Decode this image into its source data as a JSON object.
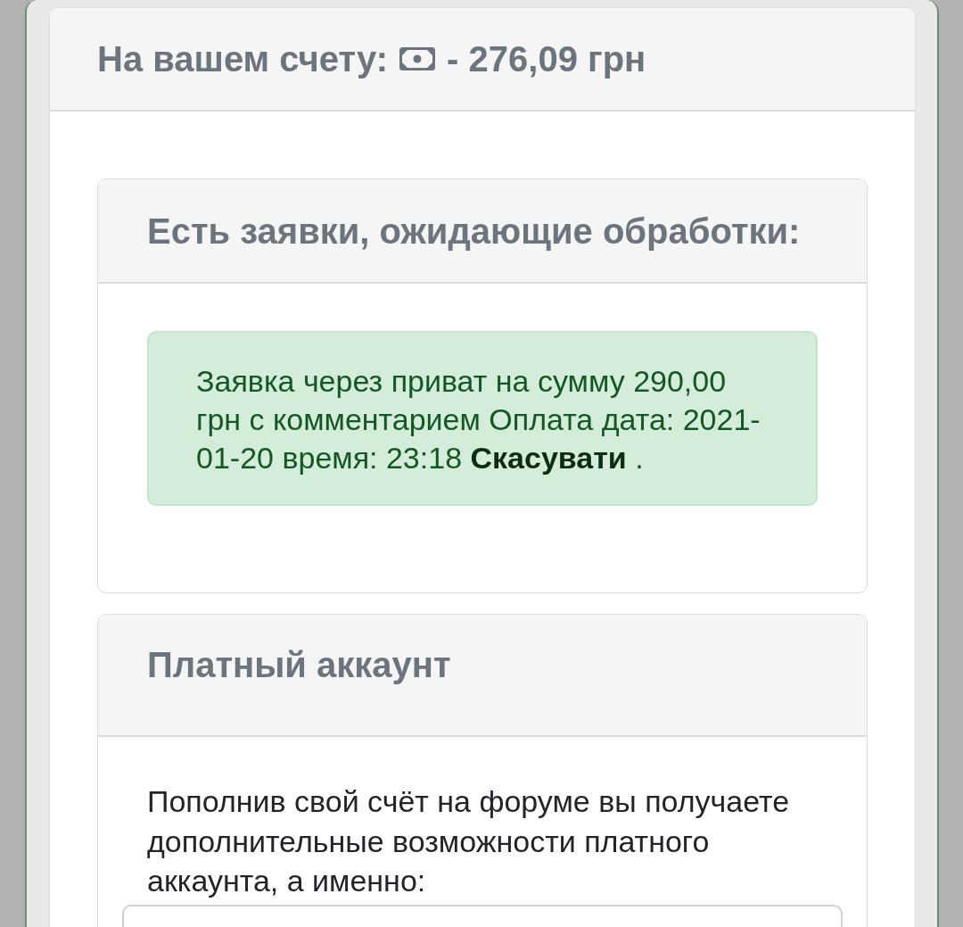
{
  "balance": {
    "label": "На вашем счету:",
    "amount": "- 276,09 грн"
  },
  "cards": [
    {
      "kind": "requests",
      "title": "Есть заявки, ожидающие обработки:",
      "alerts": [
        {
          "text": "Заявка через приват на сумму 290,00 грн с комментарием Оплата дата: 2021-01-20 время: 23:18",
          "link": "Скасувати",
          "suffix": "."
        }
      ]
    },
    {
      "kind": "info",
      "title": "Платный аккаунт",
      "paragraph": "Пополнив свой счёт на форуме вы получаете дополнительные возможности платного аккаунта, а именно:"
    }
  ]
}
